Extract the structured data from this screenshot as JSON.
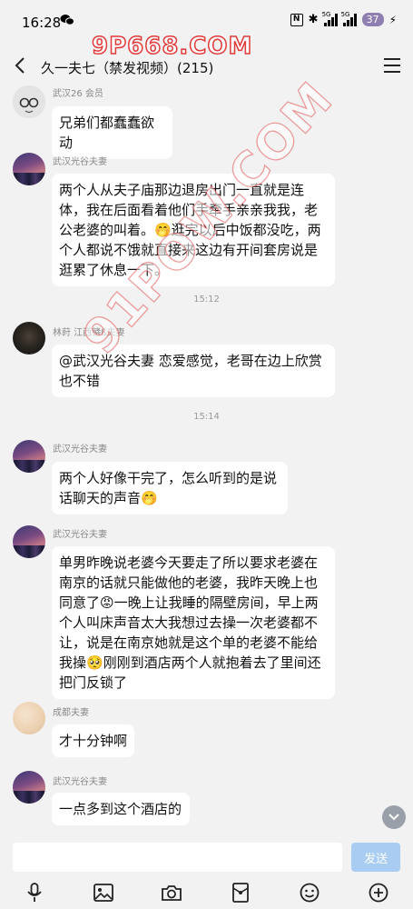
{
  "status_bar": {
    "time": "16:28",
    "network_label_1": "5G",
    "network_label_2": "5G",
    "battery": "37"
  },
  "watermark": {
    "top_text": "9P668.COM",
    "diagonal_text": "91POW.COM"
  },
  "nav": {
    "title": "久一夫七（禁发视频）(215)"
  },
  "messages": [
    {
      "sender": "武汉26 会员",
      "text": "兄弟们都蠢蠢欲动"
    },
    {
      "sender": "武汉光谷夫妻",
      "text": "两个人从夫子庙那边退房出门一直就是连体，我在后面看着他们手牵手亲亲我我，老公老婆的叫着。🤭逛完以后中饭都没吃，两个人都说不饿就直接来这边有开间套房说是逛累了休息一下。"
    },
    {
      "time": "15:12"
    },
    {
      "sender": "林莳 江西赣ß夫妻",
      "text": "@武汉光谷夫妻 恋爱感觉，老哥在边上欣赏也不错"
    },
    {
      "time": "15:14"
    },
    {
      "sender": "武汉光谷夫妻",
      "text": "两个人好像干完了，怎么听到的是说话聊天的声音🤭"
    },
    {
      "sender": "武汉光谷夫妻",
      "text": "单男昨晚说老婆今天要走了所以要求老婆在南京的话就只能做他的老婆，我昨天晚上也同意了😡一晚上让我睡的隔壁房间，早上两个人叫床声音太大我想过去操一次老婆都不让，说是在南京她就是这个单的老婆不能给我操🥺刚刚到酒店两个人就抱着去了里间还把门反锁了"
    },
    {
      "sender": "成都夫妻",
      "text": "才十分钟啊"
    },
    {
      "sender": "武汉光谷夫妻",
      "text": "一点多到这个酒店的"
    }
  ],
  "input": {
    "placeholder": "",
    "send_label": "发送"
  },
  "toolbar": {
    "items": [
      "microphone-icon",
      "image-icon",
      "camera-icon",
      "red-packet-icon",
      "emoji-icon",
      "plus-icon"
    ]
  },
  "colors": {
    "background": "#f2f2f2",
    "bubble": "#ffffff",
    "send_button": "#a9ccf2",
    "watermark": "#e03a3a"
  }
}
